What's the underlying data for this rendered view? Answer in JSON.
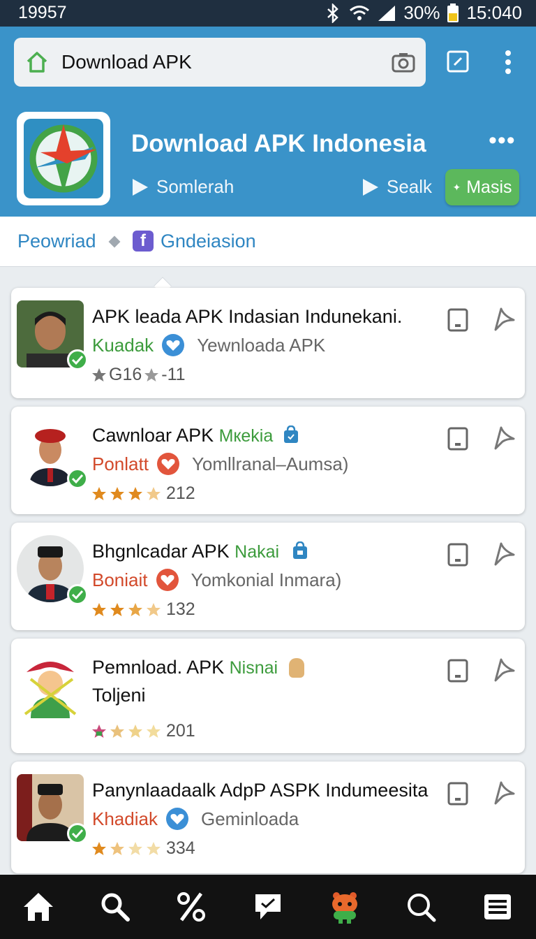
{
  "status_bar": {
    "left": "19957",
    "battery": "30%",
    "time": "15:040"
  },
  "browser": {
    "url_text": "Download APK"
  },
  "hero": {
    "title": "Download APK Indonesia",
    "links": [
      "Somlerah",
      "Sealk"
    ],
    "action_button": "Masis"
  },
  "filters": {
    "first": "Peowriad",
    "second": "Gndeiasion"
  },
  "cards": [
    {
      "title": "APK leada APK Indasian Indunekani.",
      "title_green": "",
      "author": "Kuadak",
      "source": "Yewnloada APK",
      "rating_text": "G16",
      "rating_extra": "-11"
    },
    {
      "title": "Cawnloar APK ",
      "title_green": "Mкekia",
      "author": "Ponlatt",
      "source": "Yomllranal–Aumsa)",
      "rating_text": "212"
    },
    {
      "title": "Bhgnlcadar APK ",
      "title_green": "Nakai",
      "author": "Boniait",
      "source": "Yomkonial Inmara)",
      "rating_text": "132"
    },
    {
      "title": "Pemnload. APK ",
      "title_green": "Nisnai",
      "title_line2": "Toljeni",
      "rating_text": "201"
    },
    {
      "title": "Panynlaadaalk AdpP ASPK Indumeesita",
      "title_green": "",
      "author": "Khadiak",
      "source": "Geminloada",
      "rating_text": "334"
    }
  ],
  "colors": {
    "header_blue": "#3a93c9",
    "accent_green": "#5cb85c",
    "link_blue": "#2f86c2"
  }
}
